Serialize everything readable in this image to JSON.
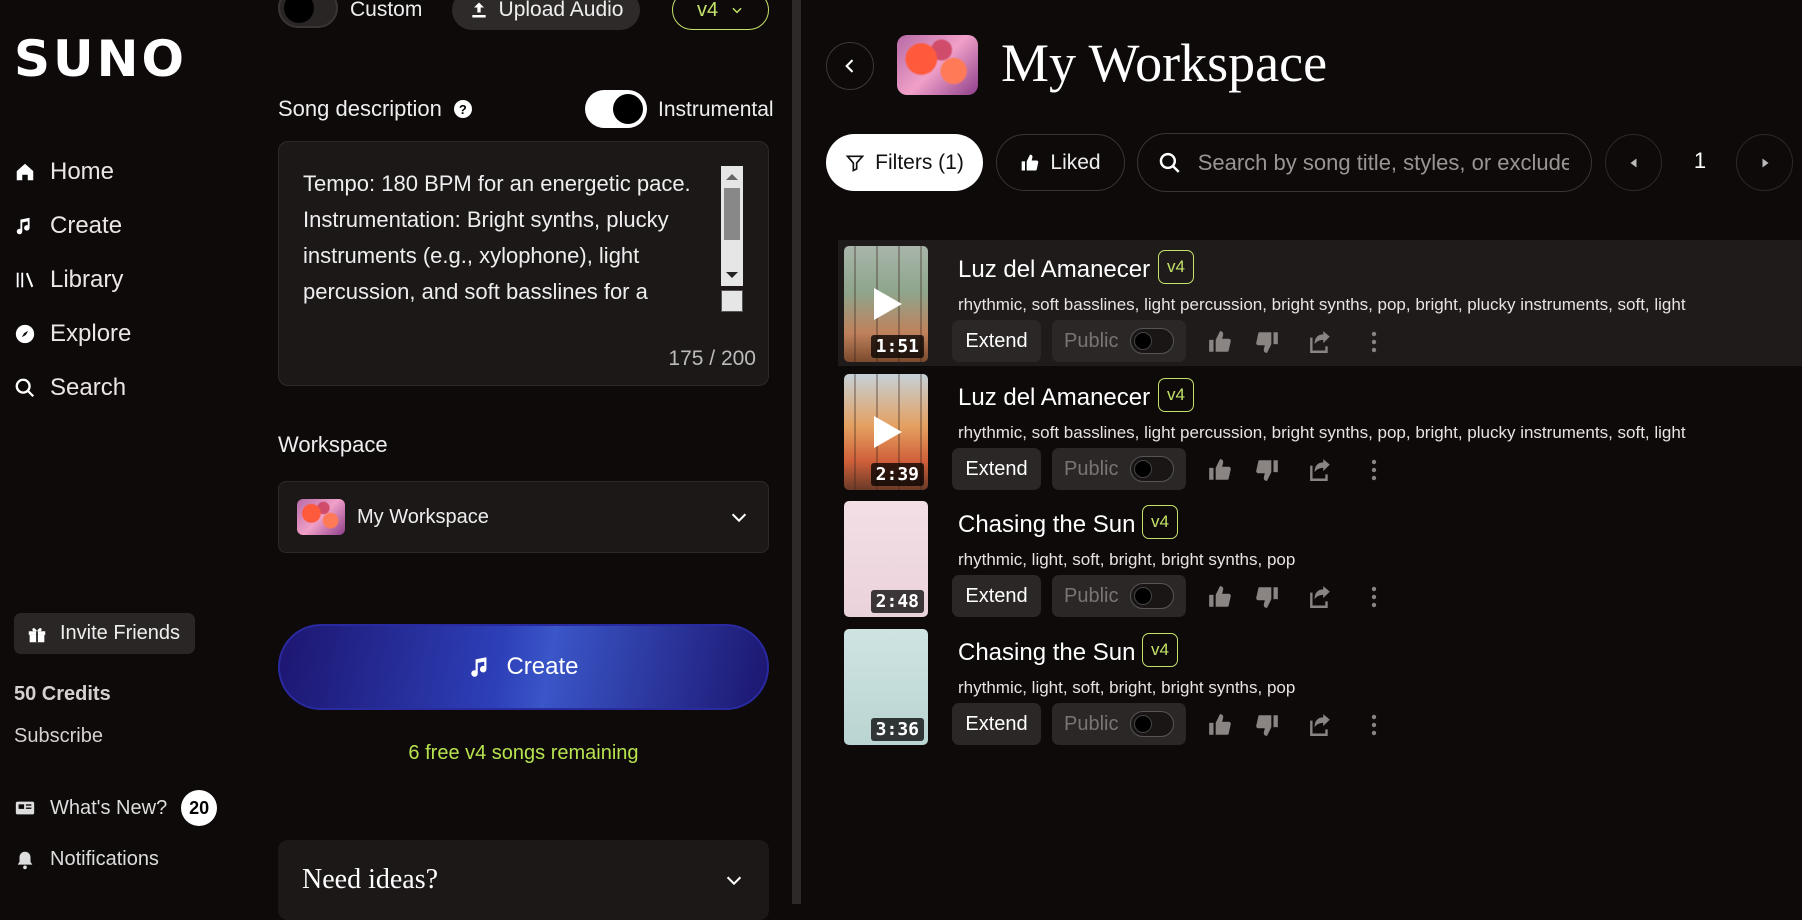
{
  "brand": {
    "logo": "SUNO"
  },
  "nav": {
    "items": [
      {
        "label": "Home",
        "icon": "home-icon"
      },
      {
        "label": "Create",
        "icon": "music-note-sparkle-icon"
      },
      {
        "label": "Library",
        "icon": "library-icon"
      },
      {
        "label": "Explore",
        "icon": "compass-icon"
      },
      {
        "label": "Search",
        "icon": "search-icon"
      }
    ],
    "invite_label": "Invite Friends",
    "credits": "50 Credits",
    "subscribe": "Subscribe",
    "whats_new": "What's New?",
    "whats_new_count": "20",
    "notifications": "Notifications"
  },
  "create_form": {
    "custom_label": "Custom",
    "upload_label": "Upload Audio",
    "version": "v4",
    "desc_label": "Song description",
    "help_glyph": "?",
    "instrumental_label": "Instrumental",
    "description": "Tempo: 180 BPM for an energetic pace.\nInstrumentation: Bright synths, plucky instruments (e.g., xylophone), light percussion, and soft basslines for a",
    "char_count": "175 / 200",
    "workspace_label": "Workspace",
    "workspace_value": "My Workspace",
    "create_label": "Create",
    "free_songs": "6 free v4 songs remaining",
    "ideas_title": "Need ideas?"
  },
  "workspace": {
    "title": "My Workspace",
    "filters_label": "Filters (1)",
    "liked_label": "Liked",
    "search_placeholder": "Search by song title, styles, or exclude",
    "page": "1",
    "extend_label": "Extend",
    "public_label": "Public",
    "songs": [
      {
        "title": "Luz del Amanecer",
        "version": "v4",
        "tags": "rhythmic, soft basslines, light percussion, bright synths, pop, bright, plucky instruments, soft, light",
        "duration": "1:51"
      },
      {
        "title": "Luz del Amanecer",
        "version": "v4",
        "tags": "rhythmic, soft basslines, light percussion, bright synths, pop, bright, plucky instruments, soft, light",
        "duration": "2:39"
      },
      {
        "title": "Chasing the Sun",
        "version": "v4",
        "tags": "rhythmic, light, soft, bright, bright synths, pop",
        "duration": "2:48"
      },
      {
        "title": "Chasing the Sun",
        "version": "v4",
        "tags": "rhythmic, light, soft, bright, bright synths, pop",
        "duration": "3:36"
      }
    ]
  },
  "colors": {
    "accent_lime": "#c4e36a",
    "free_text": "#b7e34f",
    "background": "#0e0a0a"
  }
}
